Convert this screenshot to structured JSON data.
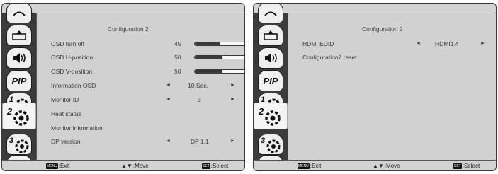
{
  "left_panel": {
    "title": "Configuration 2",
    "sidebar": [
      {
        "icon": "picture-icon"
      },
      {
        "icon": "screen-icon"
      },
      {
        "icon": "audio-icon"
      },
      {
        "icon": "pip-icon",
        "label": "PIP"
      },
      {
        "icon": "configuration1-icon",
        "number": "1"
      },
      {
        "icon": "configuration2-icon",
        "number": "2",
        "selected": true
      },
      {
        "icon": "advanced-option-icon",
        "number": "3"
      },
      {
        "icon": "input-icon"
      }
    ],
    "rows": [
      {
        "label": "OSD turn off",
        "value": "45",
        "level": 0.45
      },
      {
        "label": "OSD H-position",
        "value": "50",
        "level": 0.5
      },
      {
        "label": "OSD V-position",
        "value": "50",
        "level": 0.5
      },
      {
        "label": "Information OSD",
        "value": "10 Sec.",
        "left_arrow": "◄",
        "right_arrow": "►"
      },
      {
        "label": "Monitor ID",
        "value": "3",
        "left_arrow": "◄",
        "right_arrow": "►"
      },
      {
        "label": "Heat status"
      },
      {
        "label": "Monitor information"
      },
      {
        "label": "DP version",
        "value": "DP 1.1",
        "left_arrow": "◄",
        "right_arrow": "►"
      }
    ],
    "footer": {
      "exit_key": "MENU",
      "exit_label": ":Exit",
      "move_arrows": "▲▼",
      "move_label": ":Move",
      "select_key": "SET",
      "select_label": ":Select"
    }
  },
  "right_panel": {
    "title": "Configuration 2",
    "rows": [
      {
        "label": "HDMI EDID",
        "value": "HDMI1.4",
        "left_arrow": "◄",
        "right_arrow": "►"
      },
      {
        "label": "Configuration2 reset"
      }
    ],
    "footer": {
      "exit_key": "MENU",
      "exit_label": ":Exit",
      "move_arrows": "▲▼",
      "move_label": ":Move",
      "select_key": "SET",
      "select_label": ":Select"
    }
  }
}
